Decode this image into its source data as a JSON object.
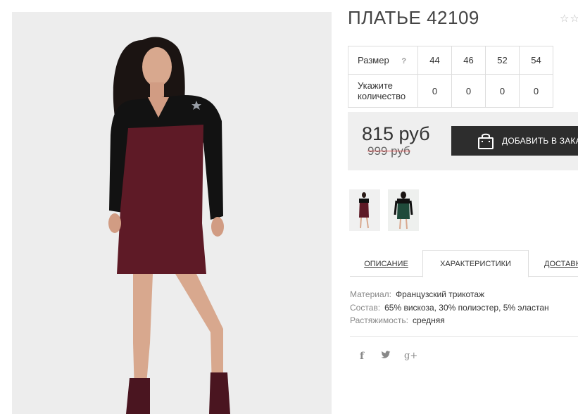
{
  "product": {
    "title": "ПЛАТЬЕ 42109",
    "rating_stars": "☆☆"
  },
  "sizes": {
    "size_label": "Размер",
    "help_icon": "?",
    "qty_label": "Укажите количество",
    "values": [
      "44",
      "46",
      "52",
      "54"
    ],
    "quantities": [
      "0",
      "0",
      "0",
      "0"
    ]
  },
  "pricing": {
    "price": "815 руб",
    "old_price": "999 руб",
    "add_button": "ДОБАВИТЬ В ЗАКАЗ"
  },
  "tabs": [
    "ОПИСАНИЕ",
    "ХАРАКТЕРИСТИКИ",
    "ДОСТАВКА"
  ],
  "specs": [
    {
      "key": "Материал:",
      "value": "Французский трикотаж"
    },
    {
      "key": "Состав:",
      "value": "65% вискоза, 30% полиэстер, 5% эластан"
    },
    {
      "key": "Растяжимость:",
      "value": "средняя"
    }
  ],
  "social": {
    "facebook": "f",
    "twitter": "🐦",
    "gplus": "g+"
  },
  "colors": {
    "dress": "#5e1a26",
    "top": "#111111",
    "button_bg": "#2d2d2d",
    "price_bg": "#efefef"
  }
}
